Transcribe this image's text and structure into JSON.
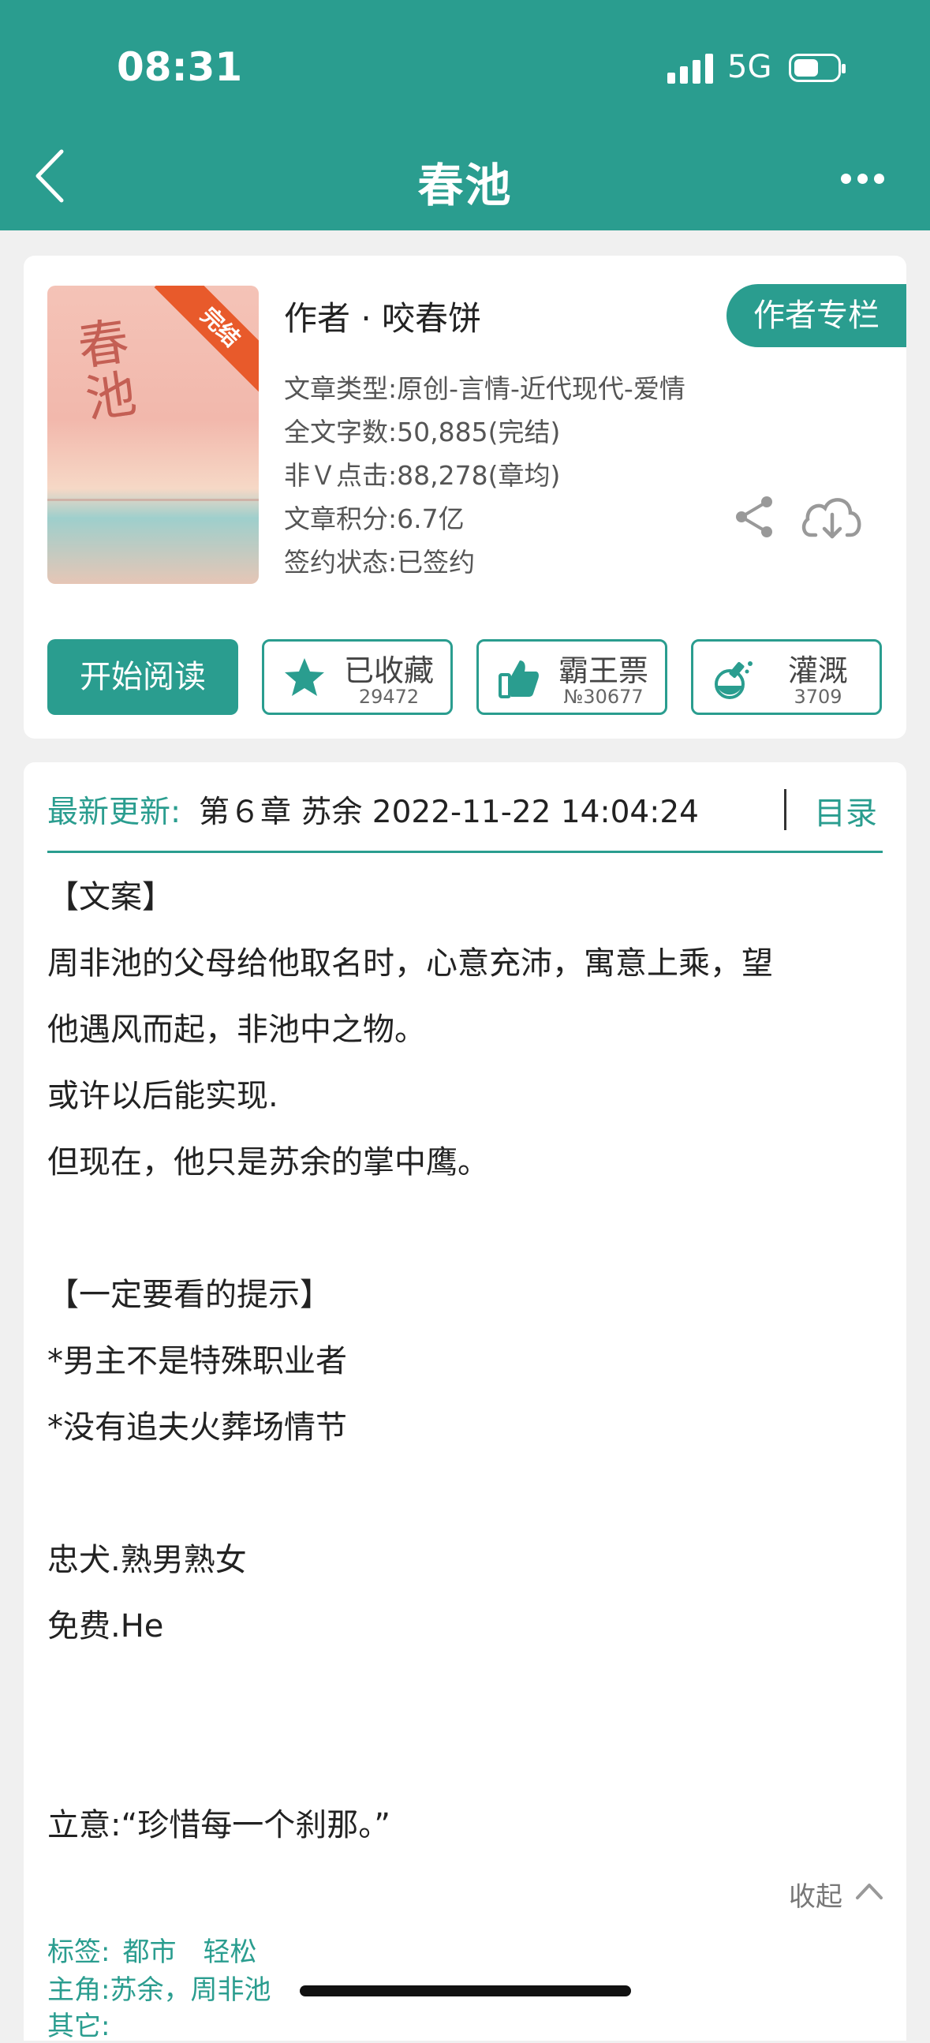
{
  "status_bar": {
    "time": "08:31",
    "network": "5G"
  },
  "nav": {
    "title": "春池"
  },
  "book": {
    "cover_text": "春池",
    "ribbon": "完结",
    "author": "作者 · 咬春饼",
    "author_column_button": "作者专栏",
    "meta": [
      "文章类型:原创-言情-近代现代-爱情",
      "全文字数:50,885(完结)",
      "非Ｖ点击:88,278(章均)",
      "文章积分:6.7亿",
      "签约状态:已签约"
    ]
  },
  "actions": {
    "read": "开始阅读",
    "favorite": {
      "label": "已收藏",
      "count": "29472"
    },
    "vote": {
      "label": "霸王票",
      "count": "№30677"
    },
    "water": {
      "label": "灌溉",
      "count": "3709"
    }
  },
  "update": {
    "label": "最新更新:",
    "text": "第６章 苏余 2022-11-22 14:04:24",
    "toc": "目录"
  },
  "synopsis": {
    "lines": [
      "【文案】",
      "周非池的父母给他取名时，心意充沛，寓意上乘，望",
      "他遇风而起，非池中之物。",
      "或许以后能实现.",
      "但现在，他只是苏余的掌中鹰。",
      "",
      "【一定要看的提示】",
      "*男主不是特殊职业者",
      "*没有追夫火葬场情节",
      "",
      "忠犬.熟男熟女",
      "免费.He",
      "",
      "",
      "立意:“珍惜每一个刹那。”"
    ],
    "collapse": "收起"
  },
  "tags": {
    "tags_label": "标签:",
    "tags_value": "都市　轻松",
    "protagonist_label": "主角:",
    "protagonist_value": "苏余，周非池",
    "other_label": "其它:"
  },
  "colors": {
    "accent": "#2a9d8f",
    "ribbon": "#e85a2b"
  }
}
